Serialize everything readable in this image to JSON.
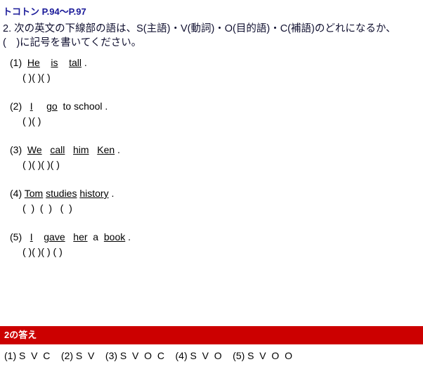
{
  "lesson": {
    "title": "トコトン P.94〜P.97",
    "title_color": "#1a1a99"
  },
  "instructions": {
    "line1": "2. 次の英文の下線部の語は、S(主語)・V(動詞)・O(目的語)・C(補語)のどれになるか、",
    "line2": "(　)に記号を書いてください。"
  },
  "questions": [
    {
      "number": "(1)",
      "sentence": "(1)  He    is    tall  .",
      "answer_slots": "( )( )( )"
    },
    {
      "number": "(2)",
      "sentence": "(2)   I     go   to school .",
      "answer_slots": "( )( )"
    },
    {
      "number": "(3)",
      "sentence": "(3)  We   call   him   Ken  .",
      "answer_slots": "( )( )( )( )"
    },
    {
      "number": "(4)",
      "sentence": "(4) Tom  studies  history  .",
      "answer_slots": "(  )  (  )   (  )"
    },
    {
      "number": "(5)",
      "sentence": "(5)   I    gave   her  a  book  .",
      "answer_slots": "( )( )( ) ( )"
    }
  ],
  "answer_key": {
    "heading": "2の答え",
    "bar_color": "#cc0000",
    "items": [
      "(1) S  V  C",
      "(2) S  V",
      "(3) S  V  O  C",
      "(4) S  V  O",
      "(5) S  V  O  O"
    ],
    "line": "(1) S  V  C    (2) S  V    (3) S  V  O  C    (4) S  V  O    (5) S  V  O  O"
  }
}
